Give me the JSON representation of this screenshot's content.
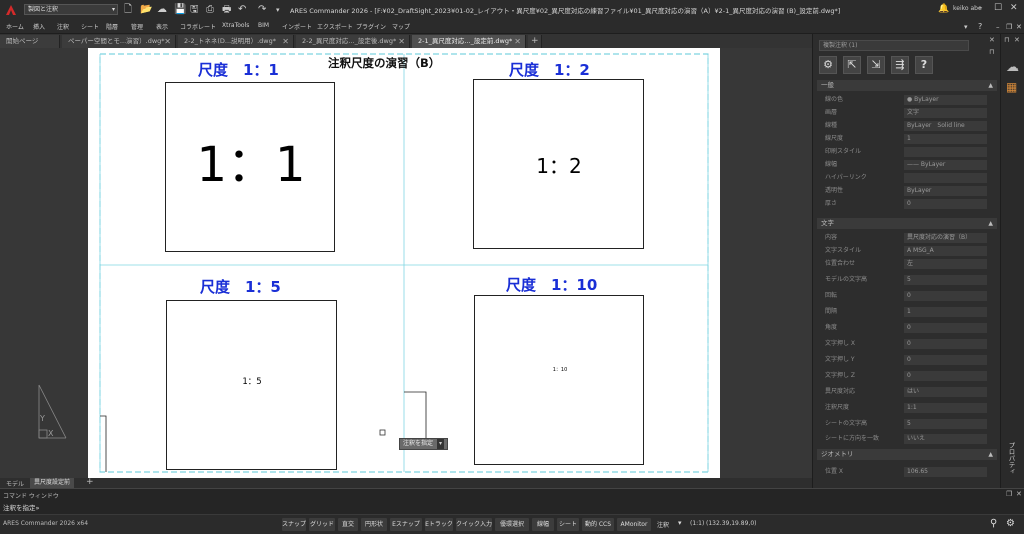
{
  "window": {
    "title": "ARES Commander 2026 - [F:¥02_DraftSight_2023¥01-02_レイアウト・異尺度¥02_異尺度対応の練習ファイル¥01_異尺度対応の演習（A）¥2-1_異尺度対応の演習 (B)_設定前.dwg*]",
    "workspace": "製図と注釈",
    "user": "keiko abe"
  },
  "ribbon_menu": [
    "ホーム",
    "挿入",
    "注釈",
    "シート",
    "階層",
    "管理",
    "表示",
    "コラボレート",
    "XtraTools",
    "BIM",
    "インポート",
    "エクスポート",
    "プラグイン",
    "マップ"
  ],
  "doc_tabs": [
    {
      "label": "開始ページ"
    },
    {
      "label": "ペーパー空間とモ...演習）.dwg*"
    },
    {
      "label": "2-2_トネネ(D...説明用）.dwg*"
    },
    {
      "label": "2-2_異尺度対応..._設定後.dwg*"
    },
    {
      "label": "2-1_異尺度対応..._設定前.dwg*"
    }
  ],
  "drawing": {
    "main_title": "注釈尺度の演習（B）",
    "viewports": [
      {
        "title": "尺度　1：1",
        "text": "1：1"
      },
      {
        "title": "尺度　1：2",
        "text": "1：2"
      },
      {
        "title": "尺度　1：5",
        "text": "1：5"
      },
      {
        "title": "尺度　1：10",
        "text": "1：10"
      }
    ],
    "tooltip": "注釈を指定"
  },
  "bottom_tabs": [
    "モデル",
    "異尺度設定前"
  ],
  "command": {
    "header": "コマンド ウィンドウ",
    "prompt": "注釈を指定»"
  },
  "status": {
    "app": "ARES Commander 2026 x64",
    "toggles": [
      "スナップ",
      "グリッド",
      "直交",
      "円形状",
      "Eスナップ",
      "Eトラック",
      "クイック入力",
      "優環選択",
      "線幅",
      "シート",
      "動的 CCS",
      "AMonitor"
    ],
    "annotation": "注釈",
    "scale": "(1:1)",
    "coords": "(132.39,19.89,0)"
  },
  "properties": {
    "selector": "複製注釈 (1)",
    "side_tab": "プロパティ",
    "sections": {
      "general": "一般",
      "text": "文字",
      "geometry": "ジオメトリ"
    },
    "general_rows": [
      {
        "label": "線の色",
        "value": "● ByLayer"
      },
      {
        "label": "画層",
        "value": "文字"
      },
      {
        "label": "線種",
        "value": "ByLayer　Solid line"
      },
      {
        "label": "線尺度",
        "value": "1"
      },
      {
        "label": "印刷スタイル",
        "value": ""
      },
      {
        "label": "線幅",
        "value": "—— ByLayer"
      },
      {
        "label": "ハイパーリンク",
        "value": ""
      },
      {
        "label": "透明性",
        "value": "ByLayer"
      },
      {
        "label": "厚さ",
        "value": "0"
      }
    ],
    "text_rows": [
      {
        "label": "内容",
        "value": "異尺度対応の演習（B）"
      },
      {
        "label": "文字スタイル",
        "value": "A  MSG_A"
      },
      {
        "label": "位置合わせ",
        "value": "左"
      },
      {
        "label": "モデルの文字高",
        "value": "5"
      },
      {
        "label": "回転",
        "value": "0"
      },
      {
        "label": "間隔",
        "value": "1"
      },
      {
        "label": "角度",
        "value": "0"
      },
      {
        "label": "文字押し X",
        "value": "0"
      },
      {
        "label": "文字押し Y",
        "value": "0"
      },
      {
        "label": "文字押し Z",
        "value": "0"
      },
      {
        "label": "異尺度対応",
        "value": "はい"
      },
      {
        "label": "注釈尺度",
        "value": "1:1"
      },
      {
        "label": "シートの文字高",
        "value": "5"
      },
      {
        "label": "シートに方向を一致",
        "value": "いいえ"
      }
    ],
    "geometry_rows": [
      {
        "label": "位置 X",
        "value": "106.65"
      }
    ]
  },
  "colors": {
    "title_blue": "#1a2fd6",
    "viewport_cyan": "#5ec8d8",
    "panel_bg": "#2d2d2d"
  }
}
